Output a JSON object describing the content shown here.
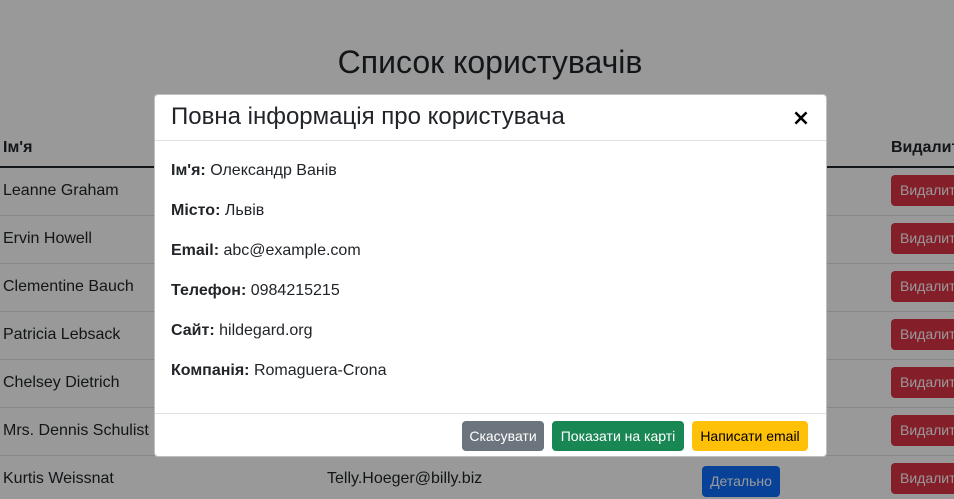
{
  "page": {
    "title": "Список користувачів"
  },
  "table": {
    "headers": {
      "name": "Ім'я",
      "delete": "Видалити"
    },
    "rows": [
      {
        "name": "Leanne Graham",
        "email": "",
        "details_label": "",
        "delete_label": "Видалити"
      },
      {
        "name": "Ervin Howell",
        "email": "",
        "details_label": "",
        "delete_label": "Видалити"
      },
      {
        "name": "Clementine Bauch",
        "email": "",
        "details_label": "",
        "delete_label": "Видалити"
      },
      {
        "name": "Patricia Lebsack",
        "email": "",
        "details_label": "",
        "delete_label": "Видалити"
      },
      {
        "name": "Chelsey Dietrich",
        "email": "",
        "details_label": "",
        "delete_label": "Видалити"
      },
      {
        "name": "Mrs. Dennis Schulist",
        "email": "",
        "details_label": "",
        "delete_label": "Видалити"
      },
      {
        "name": "Kurtis Weissnat",
        "email": "Telly.Hoeger@billy.biz",
        "details_label": "Детально",
        "delete_label": "Видалити"
      }
    ]
  },
  "modal": {
    "title": "Повна інформація про користувача",
    "close_glyph": "×",
    "fields": [
      {
        "label": "Ім'я:",
        "value": "Олександр Ванів"
      },
      {
        "label": "Місто:",
        "value": "Львів"
      },
      {
        "label": "Email:",
        "value": "abc@example.com"
      },
      {
        "label": "Телефон:",
        "value": "0984215215"
      },
      {
        "label": "Сайт:",
        "value": "hildegard.org"
      },
      {
        "label": "Компанія:",
        "value": "Romaguera-Crona"
      }
    ],
    "buttons": {
      "cancel": "Скасувати",
      "show_map": "Показати на карті",
      "write_email": "Написати email"
    }
  },
  "colors": {
    "primary": "#0d6efd",
    "danger": "#dc3545",
    "secondary": "#6c757d",
    "success": "#198754",
    "warning": "#ffc107"
  }
}
